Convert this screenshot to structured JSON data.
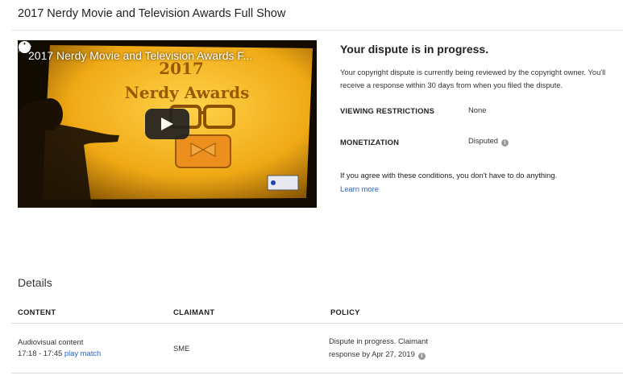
{
  "page": {
    "title": "2017 Nerdy Movie and Television Awards Full Show"
  },
  "video": {
    "overlay_title": "2017 Nerdy Movie and Television Awards F...",
    "slide_text": "2017\nNerdy Awards",
    "icons": [
      "clock-icon",
      "share-icon",
      "play-icon"
    ]
  },
  "dispute": {
    "heading": "Your dispute is in progress.",
    "description": "Your copyright dispute is currently being reviewed by the copyright owner. You'll receive a response within 30 days from when you filed the dispute.",
    "viewing_restrictions_label": "VIEWING RESTRICTIONS",
    "viewing_restrictions_value": "None",
    "monetization_label": "MONETIZATION",
    "monetization_value": "Disputed",
    "agree_note": "If you agree with these conditions, you don't have to do anything.",
    "learn_more": "Learn more"
  },
  "details": {
    "heading": "Details",
    "columns": [
      "CONTENT",
      "CLAIMANT",
      "POLICY"
    ],
    "rows": [
      {
        "content_type": "Audiovisual content",
        "time_range": "17:18 - 17:45",
        "play_match": "play match",
        "claimant": "SME",
        "policy_line1": "Dispute in progress. Claimant",
        "policy_line2": "response by Apr 27, 2019"
      }
    ]
  },
  "colors": {
    "link": "#2a62c7",
    "video_slide": "#f2b21c",
    "play_button": "#212121"
  }
}
